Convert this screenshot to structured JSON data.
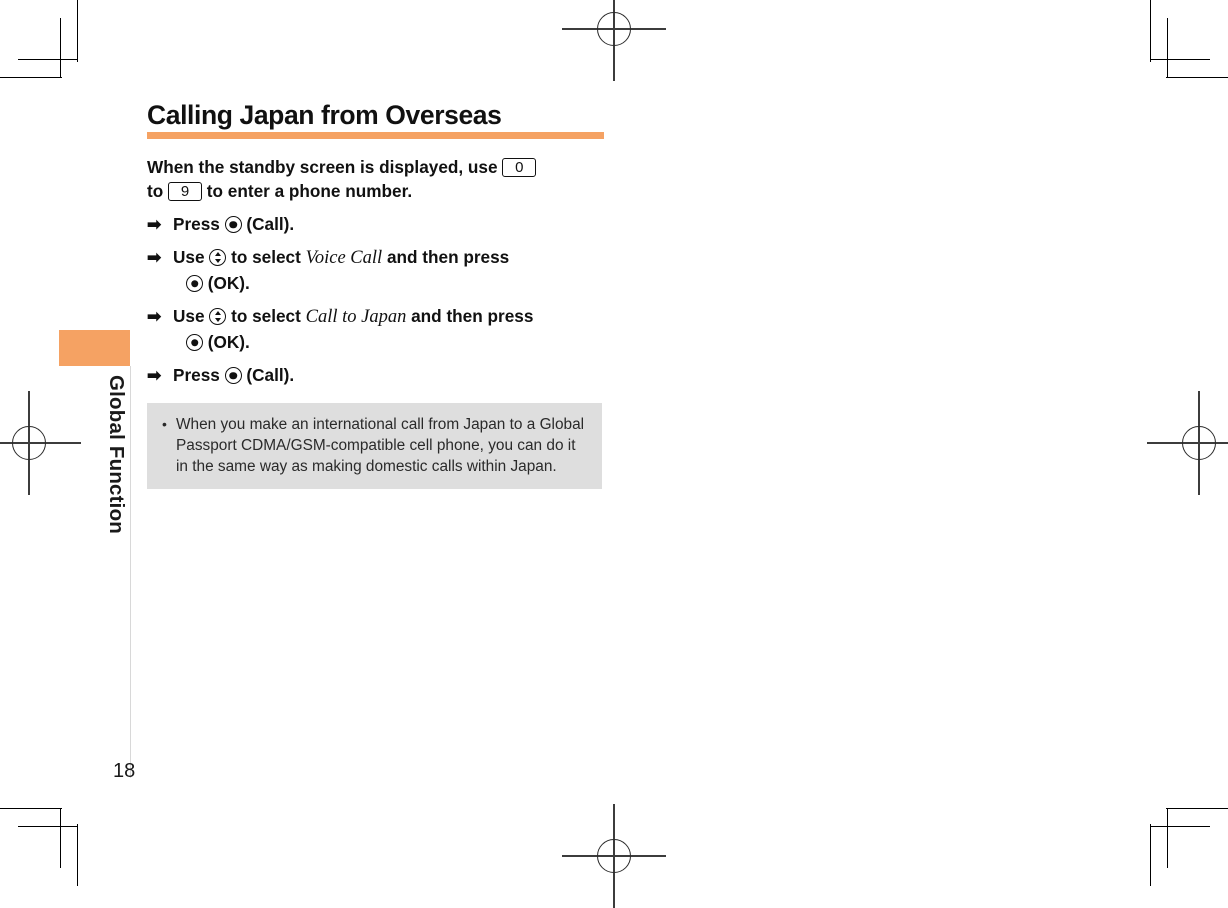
{
  "document": {
    "page_number": "18",
    "section_label": "Global Function",
    "accent_color": "#f5a263",
    "note_background": "#dedede"
  },
  "heading": {
    "title": "Calling Japan from Overseas"
  },
  "intro": {
    "part1": "When the standby screen is displayed, use",
    "key_zero": "0",
    "part2": "to",
    "key_nine": "9",
    "part3": "to enter a phone number."
  },
  "steps": [
    {
      "arrow": "➡",
      "verb": "Press",
      "key_icon": "center-key-icon",
      "label": "(Call)."
    },
    {
      "arrow": "➡",
      "verb": "Use",
      "key_icon": "nav-updown-key-icon",
      "connector": "to select",
      "item": "Voice Call",
      "tail": "and then press",
      "key_icon2": "center-key-icon",
      "label2": "(OK)."
    },
    {
      "arrow": "➡",
      "verb": "Use",
      "key_icon": "nav-updown-key-icon",
      "connector": "to select",
      "item": "Call to Japan",
      "tail": "and then press",
      "key_icon2": "center-key-icon",
      "label2": "(OK)."
    },
    {
      "arrow": "➡",
      "verb": "Press",
      "key_icon": "center-key-icon",
      "label": "(Call)."
    }
  ],
  "note": {
    "bullet": "•",
    "text": "When you make an international call from Japan to a Global Passport CDMA/GSM-compatible cell phone, you can do it in the same way as making domestic calls within Japan."
  }
}
